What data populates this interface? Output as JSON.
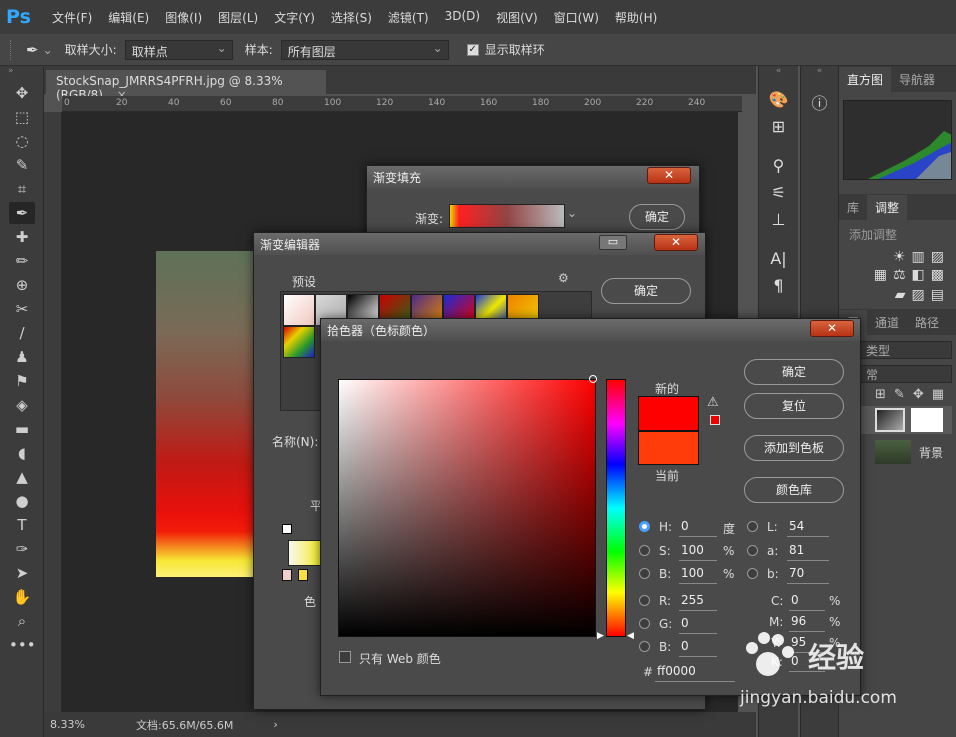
{
  "app": {
    "logo": "Ps"
  },
  "menu": [
    "文件(F)",
    "编辑(E)",
    "图像(I)",
    "图层(L)",
    "文字(Y)",
    "选择(S)",
    "滤镜(T)",
    "3D(D)",
    "视图(V)",
    "窗口(W)",
    "帮助(H)"
  ],
  "options": {
    "sample_size_label": "取样大小:",
    "sample_size_value": "取样点",
    "sample_label": "样本:",
    "sample_value": "所有图层",
    "show_ring_label": "显示取样环",
    "show_ring_checked": "✓"
  },
  "document": {
    "tab_title": "StockSnap_JMRRS4PFRH.jpg @ 8.33%(RGB/8)",
    "tab_close": "×",
    "ruler_ticks": [
      "0",
      "20",
      "40",
      "60",
      "80",
      "100",
      "120",
      "140",
      "160",
      "180",
      "200",
      "220",
      "240"
    ],
    "zoom": "8.33%",
    "doc_size": "文档:65.6M/65.6M",
    "status_arrow": "›"
  },
  "tools": [
    {
      "name": "move-tool-icon",
      "glyph": "✥"
    },
    {
      "name": "marquee-tool-icon",
      "glyph": "⬚"
    },
    {
      "name": "lasso-tool-icon",
      "glyph": "◌"
    },
    {
      "name": "quick-select-tool-icon",
      "glyph": "✎"
    },
    {
      "name": "crop-tool-icon",
      "glyph": "⌗"
    },
    {
      "name": "eyedropper-tool-icon",
      "glyph": "✒"
    },
    {
      "name": "healing-brush-tool-icon",
      "glyph": "✚"
    },
    {
      "name": "brush-tool-icon",
      "glyph": "✏"
    },
    {
      "name": "stamp-tool-icon",
      "glyph": "⊕"
    },
    {
      "name": "history-brush-tool-icon",
      "glyph": "✂"
    },
    {
      "name": "eraser-tool-icon",
      "glyph": "∕"
    },
    {
      "name": "clone-stamp-tool-icon",
      "glyph": "♟"
    },
    {
      "name": "history-tool-icon",
      "glyph": "⚑"
    },
    {
      "name": "eraser2-tool-icon",
      "glyph": "◈"
    },
    {
      "name": "gradient-tool-icon",
      "glyph": "▬"
    },
    {
      "name": "blur-tool-icon",
      "glyph": "◖"
    },
    {
      "name": "sharpen-tool-icon",
      "glyph": "▲"
    },
    {
      "name": "dodge-tool-icon",
      "glyph": "●"
    },
    {
      "name": "type-tool-icon",
      "glyph": "T"
    },
    {
      "name": "pen-tool-icon",
      "glyph": "✑"
    },
    {
      "name": "path-select-tool-icon",
      "glyph": "➤"
    },
    {
      "name": "hand-tool-icon",
      "glyph": "✋"
    },
    {
      "name": "zoom-tool-icon",
      "glyph": "⌕"
    },
    {
      "name": "more-tools-icon",
      "glyph": "•••"
    }
  ],
  "right_panels": {
    "tabs_top": [
      "直方图",
      "导航器"
    ],
    "tabs_mid": [
      "库",
      "调整"
    ],
    "add_adjustment": "添加调整",
    "tabs_layers": [
      "层",
      "通道",
      "路径"
    ],
    "kind_label": "类型",
    "normal_label": "常",
    "layer_bg_name": "背景"
  },
  "gradient_fill": {
    "title": "渐变填充",
    "gradient_label": "渐变:",
    "ok": "确定"
  },
  "gradient_editor": {
    "title": "渐变编辑器",
    "presets_label": "预设",
    "ok": "确定",
    "name_label": "名称(N):",
    "flat_label": "平",
    "color_label": "色"
  },
  "color_picker": {
    "title": "拾色器（色标颜色）",
    "new_label": "新的",
    "current_label": "当前",
    "new_color": "#ff0000",
    "current_color": "#ff3c0a",
    "ok": "确定",
    "reset": "复位",
    "add_swatch": "添加到色板",
    "color_lib": "颜色库",
    "web_only_label": "只有 Web 颜色",
    "fields": {
      "H": {
        "label": "H:",
        "value": "0",
        "unit": "度"
      },
      "S": {
        "label": "S:",
        "value": "100",
        "unit": "%"
      },
      "Bv": {
        "label": "B:",
        "value": "100",
        "unit": "%"
      },
      "R": {
        "label": "R:",
        "value": "255"
      },
      "G": {
        "label": "G:",
        "value": "0"
      },
      "B": {
        "label": "B:",
        "value": "0"
      },
      "L": {
        "label": "L:",
        "value": "54"
      },
      "a": {
        "label": "a:",
        "value": "81"
      },
      "b": {
        "label": "b:",
        "value": "70"
      },
      "C": {
        "label": "C:",
        "value": "0",
        "unit": "%"
      },
      "M": {
        "label": "M:",
        "value": "96",
        "unit": "%"
      },
      "Y": {
        "label": "Y:",
        "value": "95",
        "unit": "%"
      },
      "K": {
        "label": "K:",
        "value": "0"
      },
      "hex_label": "#",
      "hex": "ff0000"
    }
  },
  "watermark": {
    "brand": "经验",
    "site": "jingyan.baidu.com"
  }
}
